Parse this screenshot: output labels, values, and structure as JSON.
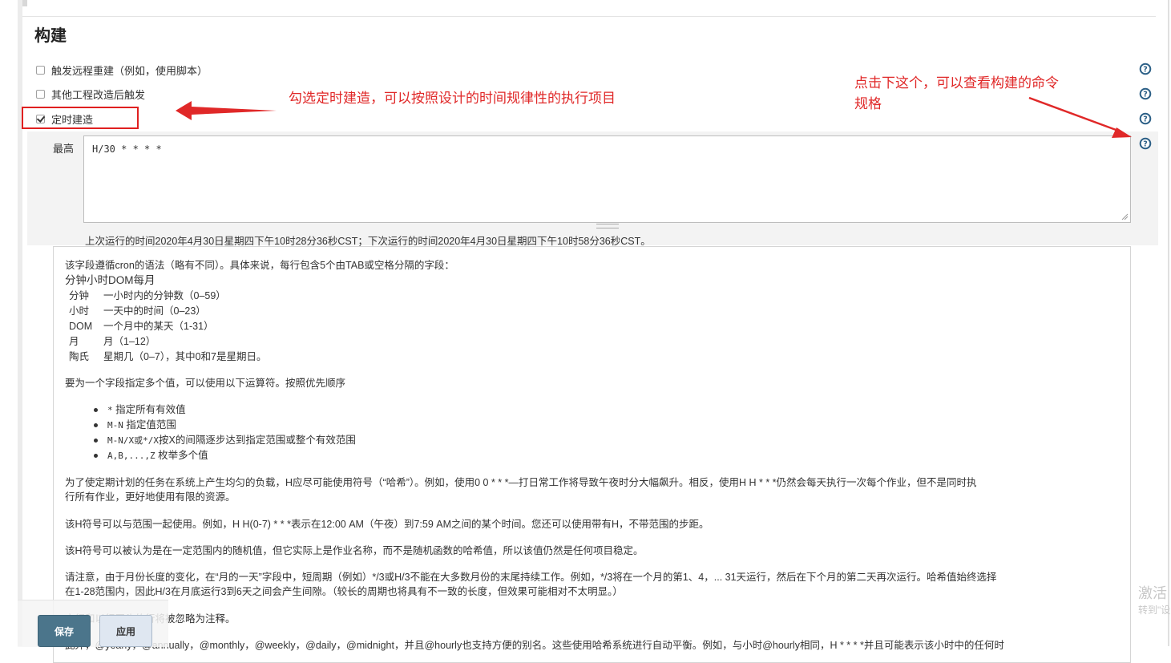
{
  "section": {
    "title": "构建"
  },
  "triggers": [
    {
      "label": "触发远程重建（例如，使用脚本）",
      "checked": false
    },
    {
      "label": "其他工程改造后触发",
      "checked": false
    },
    {
      "label": "定时建造",
      "checked": true
    }
  ],
  "schedule": {
    "label": "最高",
    "value": "H/30 * * * *",
    "info": "上次运行的时间2020年4月30日星期四下午10时28分36秒CST；下次运行的时间2020年4月30日星期四下午10时58分36秒CST。"
  },
  "help_text": {
    "intro": "该字段遵循cron的语法（略有不同）。具体来说，每行包含5个由TAB或空格分隔的字段：",
    "fields_header": "分钟小时DOM每月",
    "fields": [
      {
        "name": "分钟",
        "desc": "一小时内的分钟数（0–59）"
      },
      {
        "name": "小时",
        "desc": "一天中的时间（0–23）"
      },
      {
        "name": "DOM",
        "desc": "一个月中的某天（1-31）"
      },
      {
        "name": "月",
        "desc": "月（1–12）"
      },
      {
        "name": "陶氏",
        "desc": "星期几（0–7），其中0和7是星期日。"
      }
    ],
    "operators_intro": "要为一个字段指定多个值，可以使用以下运算符。按照优先顺序",
    "operators": [
      {
        "code": "*",
        "text": " 指定所有有效值"
      },
      {
        "code": "M-N",
        "text": " 指定值范围"
      },
      {
        "code": "M-N/X或*/X",
        "text": "按X的间隔逐步达到指定范围或整个有效范围"
      },
      {
        "code": "A,B,...,Z",
        "text": " 枚举多个值"
      }
    ],
    "para_hash_1": "为了使定期计划的任务在系统上产生均匀的负载，H应尽可能使用符号（“哈希”）。例如，使用0 0 * * *—打日常工作将导致午夜时分大幅飙升。相反，使用H H * * *仍然会每天执行一次每个作业，但不是同时执",
    "para_hash_2": "行所有作业，更好地使用有限的资源。",
    "para_range": "该H符号可以与范围一起使用。例如，H H(0-7) * * *表示在12:00 AM（午夜）到7:59 AM之间的某个时间。您还可以使用带有H，不带范围的步距。",
    "para_random": "该H符号可以被认为是在一定范围内的随机值，但它实际上是作业名称，而不是随机函数的哈希值，所以该值仍然是任何项目稳定。",
    "para_note_1": "请注意，由于月份长度的变化，在“月的一天”字段中，短周期（例如）*/3或H/3不能在大多数月份的末尾持续工作。例如，*/3将在一个月的第1、4，... 31天运行，然后在下个月的第二天再次运行。哈希值始终选择",
    "para_note_2": "在1-28范围内，因此H/3在月底运行3到6天之间会产生间隙。（较长的周期也将具有不一致的长度，但效果可能相对不太明显。）",
    "para_comment": "空行和以行开头的行将被忽略为注释。",
    "para_alias": "此外，@yearly，@annually，@monthly，@weekly，@daily，@midnight，并且@hourly也支持方便的别名。这些使用哈希系统进行自动平衡。例如，与小时@hourly相同，H * * * *并且可能表示该小时中的任何时"
  },
  "annotations": {
    "left": "勾选定时建造，可以按照设计的时间规律性的执行项目",
    "right_line1": "点击下这个，可以查看构建的命令",
    "right_line2": "规格"
  },
  "buttons": {
    "save": "保存",
    "apply": "应用"
  },
  "watermark": {
    "main": "激活",
    "sub": "转到\"设"
  },
  "colors": {
    "annotation_red": "#e02828",
    "save_button": "#4b758b",
    "help_icon": "#2b5f86"
  }
}
